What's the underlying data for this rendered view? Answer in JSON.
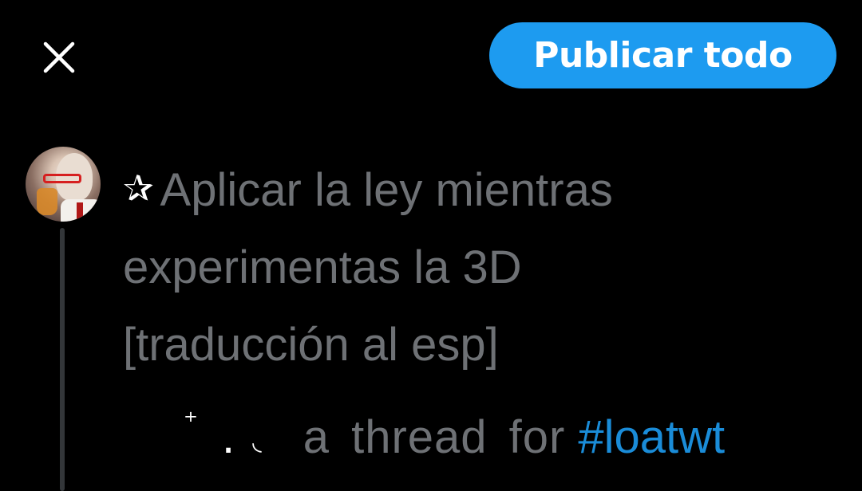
{
  "header": {
    "close_icon": "close-icon",
    "publish_label": "Publicar todo",
    "accent_color": "#1d9bf0"
  },
  "post": {
    "star_glyph": "✰",
    "line1": "Aplicar la ley mientras",
    "line2": "experimentas la 3D",
    "line3": "[traducción al esp]",
    "deco_plus": "⁺",
    "deco_dot": ".",
    "deco_moon": "◟",
    "line4_text": "a  thread  for",
    "hashtag": "#loatwt",
    "text_color": "#6e7175",
    "hashtag_color": "#1a8cd8"
  },
  "avatar": {
    "icon": "user-avatar"
  }
}
